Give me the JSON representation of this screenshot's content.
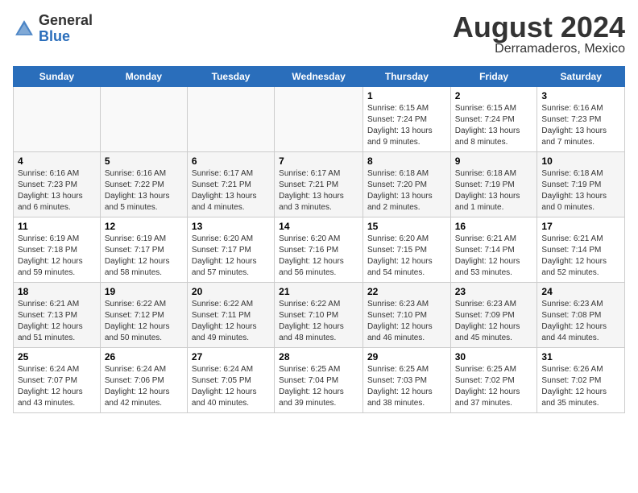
{
  "header": {
    "logo_general": "General",
    "logo_blue": "Blue",
    "title": "August 2024",
    "subtitle": "Derramaderos, Mexico"
  },
  "calendar": {
    "days_of_week": [
      "Sunday",
      "Monday",
      "Tuesday",
      "Wednesday",
      "Thursday",
      "Friday",
      "Saturday"
    ],
    "weeks": [
      [
        {
          "day": "",
          "info": ""
        },
        {
          "day": "",
          "info": ""
        },
        {
          "day": "",
          "info": ""
        },
        {
          "day": "",
          "info": ""
        },
        {
          "day": "1",
          "info": "Sunrise: 6:15 AM\nSunset: 7:24 PM\nDaylight: 13 hours and 9 minutes."
        },
        {
          "day": "2",
          "info": "Sunrise: 6:15 AM\nSunset: 7:24 PM\nDaylight: 13 hours and 8 minutes."
        },
        {
          "day": "3",
          "info": "Sunrise: 6:16 AM\nSunset: 7:23 PM\nDaylight: 13 hours and 7 minutes."
        }
      ],
      [
        {
          "day": "4",
          "info": "Sunrise: 6:16 AM\nSunset: 7:23 PM\nDaylight: 13 hours and 6 minutes."
        },
        {
          "day": "5",
          "info": "Sunrise: 6:16 AM\nSunset: 7:22 PM\nDaylight: 13 hours and 5 minutes."
        },
        {
          "day": "6",
          "info": "Sunrise: 6:17 AM\nSunset: 7:21 PM\nDaylight: 13 hours and 4 minutes."
        },
        {
          "day": "7",
          "info": "Sunrise: 6:17 AM\nSunset: 7:21 PM\nDaylight: 13 hours and 3 minutes."
        },
        {
          "day": "8",
          "info": "Sunrise: 6:18 AM\nSunset: 7:20 PM\nDaylight: 13 hours and 2 minutes."
        },
        {
          "day": "9",
          "info": "Sunrise: 6:18 AM\nSunset: 7:19 PM\nDaylight: 13 hours and 1 minute."
        },
        {
          "day": "10",
          "info": "Sunrise: 6:18 AM\nSunset: 7:19 PM\nDaylight: 13 hours and 0 minutes."
        }
      ],
      [
        {
          "day": "11",
          "info": "Sunrise: 6:19 AM\nSunset: 7:18 PM\nDaylight: 12 hours and 59 minutes."
        },
        {
          "day": "12",
          "info": "Sunrise: 6:19 AM\nSunset: 7:17 PM\nDaylight: 12 hours and 58 minutes."
        },
        {
          "day": "13",
          "info": "Sunrise: 6:20 AM\nSunset: 7:17 PM\nDaylight: 12 hours and 57 minutes."
        },
        {
          "day": "14",
          "info": "Sunrise: 6:20 AM\nSunset: 7:16 PM\nDaylight: 12 hours and 56 minutes."
        },
        {
          "day": "15",
          "info": "Sunrise: 6:20 AM\nSunset: 7:15 PM\nDaylight: 12 hours and 54 minutes."
        },
        {
          "day": "16",
          "info": "Sunrise: 6:21 AM\nSunset: 7:14 PM\nDaylight: 12 hours and 53 minutes."
        },
        {
          "day": "17",
          "info": "Sunrise: 6:21 AM\nSunset: 7:14 PM\nDaylight: 12 hours and 52 minutes."
        }
      ],
      [
        {
          "day": "18",
          "info": "Sunrise: 6:21 AM\nSunset: 7:13 PM\nDaylight: 12 hours and 51 minutes."
        },
        {
          "day": "19",
          "info": "Sunrise: 6:22 AM\nSunset: 7:12 PM\nDaylight: 12 hours and 50 minutes."
        },
        {
          "day": "20",
          "info": "Sunrise: 6:22 AM\nSunset: 7:11 PM\nDaylight: 12 hours and 49 minutes."
        },
        {
          "day": "21",
          "info": "Sunrise: 6:22 AM\nSunset: 7:10 PM\nDaylight: 12 hours and 48 minutes."
        },
        {
          "day": "22",
          "info": "Sunrise: 6:23 AM\nSunset: 7:10 PM\nDaylight: 12 hours and 46 minutes."
        },
        {
          "day": "23",
          "info": "Sunrise: 6:23 AM\nSunset: 7:09 PM\nDaylight: 12 hours and 45 minutes."
        },
        {
          "day": "24",
          "info": "Sunrise: 6:23 AM\nSunset: 7:08 PM\nDaylight: 12 hours and 44 minutes."
        }
      ],
      [
        {
          "day": "25",
          "info": "Sunrise: 6:24 AM\nSunset: 7:07 PM\nDaylight: 12 hours and 43 minutes."
        },
        {
          "day": "26",
          "info": "Sunrise: 6:24 AM\nSunset: 7:06 PM\nDaylight: 12 hours and 42 minutes."
        },
        {
          "day": "27",
          "info": "Sunrise: 6:24 AM\nSunset: 7:05 PM\nDaylight: 12 hours and 40 minutes."
        },
        {
          "day": "28",
          "info": "Sunrise: 6:25 AM\nSunset: 7:04 PM\nDaylight: 12 hours and 39 minutes."
        },
        {
          "day": "29",
          "info": "Sunrise: 6:25 AM\nSunset: 7:03 PM\nDaylight: 12 hours and 38 minutes."
        },
        {
          "day": "30",
          "info": "Sunrise: 6:25 AM\nSunset: 7:02 PM\nDaylight: 12 hours and 37 minutes."
        },
        {
          "day": "31",
          "info": "Sunrise: 6:26 AM\nSunset: 7:02 PM\nDaylight: 12 hours and 35 minutes."
        }
      ]
    ]
  }
}
